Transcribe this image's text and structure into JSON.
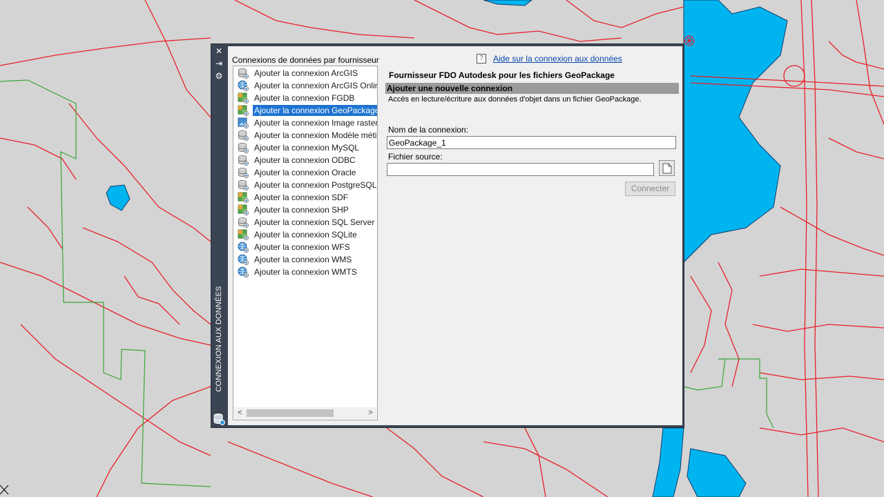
{
  "palette": {
    "title": "CONNEXION AUX DONNÉES",
    "buttons": {
      "close": "✕",
      "pin": "⇥",
      "properties": "⚙"
    }
  },
  "provider_list": {
    "caption": "Connexions de données par fournisseur",
    "selected_index": 3,
    "items": [
      {
        "label": "Ajouter la connexion ArcGIS",
        "icon": "db-server-icon"
      },
      {
        "label": "Ajouter la connexion ArcGIS Online",
        "icon": "globe-icon"
      },
      {
        "label": "Ajouter la connexion FGDB",
        "icon": "raster-file-icon"
      },
      {
        "label": "Ajouter la connexion GeoPackage",
        "icon": "raster-file-icon"
      },
      {
        "label": "Ajouter la connexion Image raster",
        "icon": "image-raster-icon"
      },
      {
        "label": "Ajouter la connexion Modèle métier",
        "icon": "db-server-icon"
      },
      {
        "label": "Ajouter la connexion MySQL",
        "icon": "db-server-icon"
      },
      {
        "label": "Ajouter la connexion ODBC",
        "icon": "db-server-icon"
      },
      {
        "label": "Ajouter la connexion Oracle",
        "icon": "db-server-icon"
      },
      {
        "label": "Ajouter la connexion PostgreSQL",
        "icon": "db-server-icon"
      },
      {
        "label": "Ajouter la connexion SDF",
        "icon": "raster-file-icon"
      },
      {
        "label": "Ajouter la connexion SHP",
        "icon": "raster-file-icon"
      },
      {
        "label": "Ajouter la connexion SQL Server Spatial",
        "icon": "db-server-icon"
      },
      {
        "label": "Ajouter la connexion SQLite",
        "icon": "raster-file-icon"
      },
      {
        "label": "Ajouter la connexion WFS",
        "icon": "globe-icon"
      },
      {
        "label": "Ajouter la connexion WMS",
        "icon": "globe-icon"
      },
      {
        "label": "Ajouter la connexion WMTS",
        "icon": "globe-icon"
      }
    ],
    "scroll_left": "<",
    "scroll_right": ">"
  },
  "detail": {
    "help_icon": "?",
    "help_link": "Aide sur la connexion aux données",
    "provider_title": "Fournisseur FDO Autodesk pour les fichiers GeoPackage",
    "section_title": "Ajouter une nouvelle connexion",
    "description": "Accès en lecture/écriture aux données d'objet dans un fichier GeoPackage.",
    "connection_name_label": "Nom de la connexion:",
    "connection_name_value": "GeoPackage_1",
    "source_file_label": "Fichier source:",
    "source_file_value": "",
    "connect_button": "Connecter"
  },
  "colors": {
    "road": "#e8202a",
    "boundary": "#3aa535",
    "water": "#00b4f0",
    "map_bg": "#d4d4d4",
    "palette_frame": "#3b4453",
    "selection": "#1e73d0"
  }
}
